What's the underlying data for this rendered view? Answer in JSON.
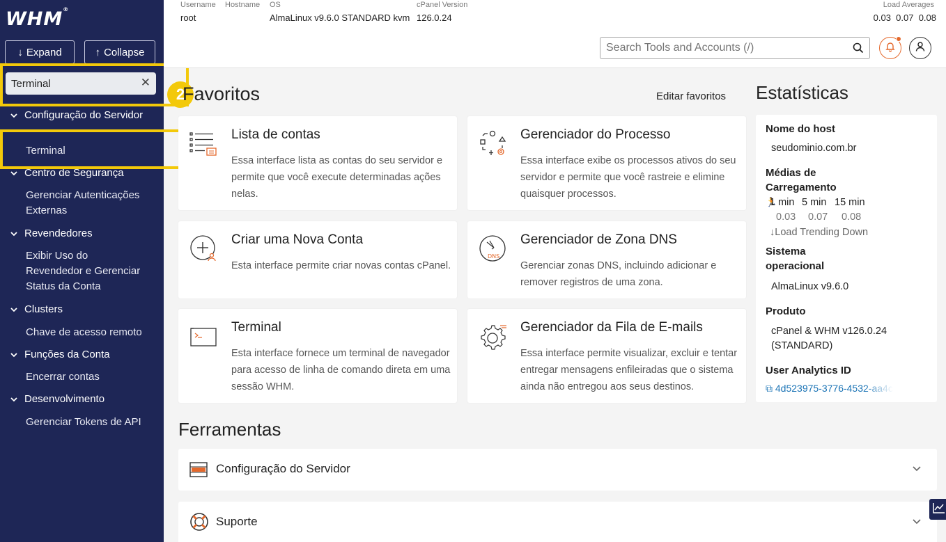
{
  "sidebar": {
    "logo": "WHM",
    "expand_label": "Expand",
    "collapse_label": "Collapse",
    "search_value": "Terminal",
    "sections": [
      {
        "label": "Configuração do Servidor",
        "items": [
          "Terminal"
        ]
      },
      {
        "label": "Centro de Segurança",
        "items": [
          "Gerenciar Autenticações Externas"
        ]
      },
      {
        "label": "Revendedores",
        "items": [
          "Exibir Uso do Revendedor e Gerenciar Status da Conta"
        ]
      },
      {
        "label": "Clusters",
        "items": [
          "Chave de acesso remoto"
        ]
      },
      {
        "label": "Funções da Conta",
        "items": [
          "Encerrar contas"
        ]
      },
      {
        "label": "Desenvolvimento",
        "items": [
          "Gerenciar Tokens de API"
        ]
      }
    ],
    "step_badge": "2"
  },
  "topbar": {
    "username_label": "Username",
    "username": "root",
    "hostname_label": "Hostname",
    "os_label": "OS",
    "os": "AlmaLinux v9.6.0 STANDARD kvm",
    "cpanel_label": "cPanel Version",
    "cpanel": "126.0.24",
    "load_label": "Load Averages",
    "load": "0.03  0.07  0.08",
    "search_placeholder": "Search Tools and Accounts (/)"
  },
  "favorites": {
    "title": "Favoritos",
    "edit": "Editar favoritos",
    "cards": [
      {
        "title": "Lista de contas",
        "desc": "Essa interface lista as contas do seu servidor e permite que você execute determinadas ações nelas.",
        "icon": "account-list-icon"
      },
      {
        "title": "Gerenciador do Processo",
        "desc": "Essa interface exibe os processos ativos do seu servidor e permite que você rastreie e elimine quaisquer processos.",
        "icon": "process-manager-icon"
      },
      {
        "title": "Criar uma Nova Conta",
        "desc": "Esta interface permite criar novas contas cPanel.",
        "icon": "create-account-icon"
      },
      {
        "title": "Gerenciador de Zona DNS",
        "desc": "Gerenciar zonas DNS, incluindo adicionar e remover registros de uma zona.",
        "icon": "dns-zone-icon"
      },
      {
        "title": "Terminal",
        "desc": "Esta interface fornece um terminal de navegador para acesso de linha de comando direta em uma sessão WHM.",
        "icon": "terminal-icon"
      },
      {
        "title": "Gerenciador da Fila de E-mails",
        "desc": "Essa interface permite visualizar, excluir e tentar entregar mensagens enfileiradas que o sistema ainda não entregou aos seus destinos.",
        "icon": "mail-queue-icon"
      }
    ]
  },
  "tools": {
    "title": "Ferramentas",
    "sections": [
      "Configuração do Servidor",
      "Suporte"
    ]
  },
  "stats": {
    "title": "Estatísticas",
    "hostname_label": "Nome do host",
    "hostname": "seudominio.com.br",
    "load_label": "Médias de Carregamento",
    "load_headers": [
      "1 min",
      "5 min",
      "15 min"
    ],
    "load_values": [
      "0.03",
      "0.07",
      "0.08"
    ],
    "load_trend": "Load Trending Down",
    "os_label": "Sistema operacional",
    "os": "AlmaLinux v9.6.0",
    "product_label": "Produto",
    "product": "cPanel & WHM v126.0.24 (STANDARD)",
    "analytics_label": "User Analytics ID",
    "analytics_id": "4d523975-3776-4532-aa4c"
  },
  "colors": {
    "sidebar_bg": "#1e2656",
    "highlight": "#f3c90a",
    "accent_orange": "#e4682b",
    "link_blue": "#1a73b5"
  }
}
